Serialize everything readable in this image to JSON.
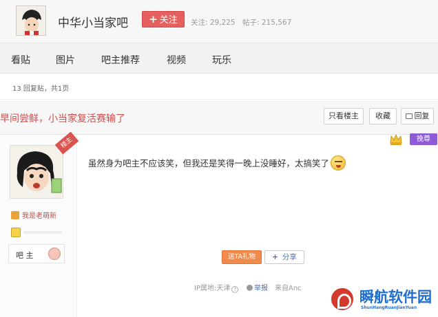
{
  "forum": {
    "name": "中华小当家吧",
    "follow_button": "关注",
    "follow_stat": "关注: 29,225",
    "posts_stat": "帖子: 215,567"
  },
  "nav": {
    "items": [
      "看贴",
      "图片",
      "吧主推荐",
      "视频",
      "玩乐"
    ]
  },
  "thread": {
    "reply_count": "13 回复贴，共1页",
    "title": "早间尝鲜，小当家复活赛输了",
    "buttons": {
      "only_landlord": "只看楼主",
      "collect": "收藏",
      "reply": "回复"
    }
  },
  "post": {
    "louzhu_tag": "楼主",
    "username": "我是老萌新",
    "admin_label": "吧 主",
    "content": "虽然身为吧主不应该笑，但我还是笑得一晚上没睡好，太搞笑了",
    "like_badge": "挽尊",
    "gift_button": "送TA礼物",
    "share_button": "分享",
    "ip_location": "IP属地:天津",
    "report": "举报",
    "from": "来自Anc"
  },
  "watermark": {
    "name": "瞬航软件园",
    "sub": "ShunHangRuanJianYuan"
  }
}
